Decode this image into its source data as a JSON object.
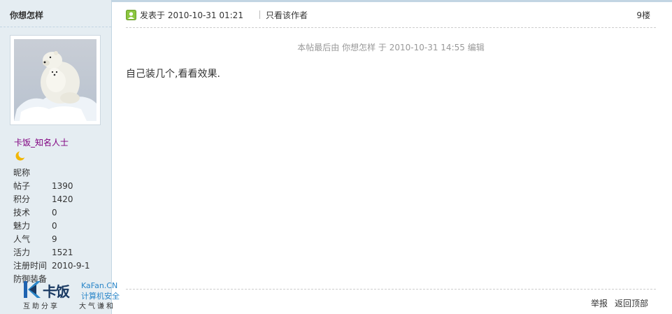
{
  "author": {
    "username": "你想怎样",
    "rank": "卡饭_知名人士",
    "rank_icon": "crescent-moon-icon",
    "stats": [
      {
        "label": "昵称",
        "value": ""
      },
      {
        "label": "帖子",
        "value": "1390"
      },
      {
        "label": "积分",
        "value": "1420"
      },
      {
        "label": "技术",
        "value": "0"
      },
      {
        "label": "魅力",
        "value": "0"
      },
      {
        "label": "人气",
        "value": "9"
      },
      {
        "label": "活力",
        "value": "1521"
      },
      {
        "label": "注册时间",
        "value": "2010-9-1"
      },
      {
        "label": "防御装备",
        "value": ""
      }
    ]
  },
  "post": {
    "time": "发表于 2010-10-31 01:21",
    "only_author": "只看该作者",
    "floor": "9楼",
    "edit_note": "本帖最后由 你想怎样 于 2010-10-31 14:55 编辑",
    "content": "自己装几个,看看效果."
  },
  "footer": {
    "report": "举报",
    "back_top": "返回顶部"
  },
  "watermark": {
    "name": "卡饭",
    "domain": "KaFan.CN",
    "tagline": "计算机安全",
    "slogan_left": "互助分享",
    "slogan_right": "大气谦和"
  },
  "colors": {
    "sidebar_bg": "#e5edf2",
    "border": "#c2d5e3",
    "rank": "#800080",
    "brand_blue": "#2a86c9"
  }
}
